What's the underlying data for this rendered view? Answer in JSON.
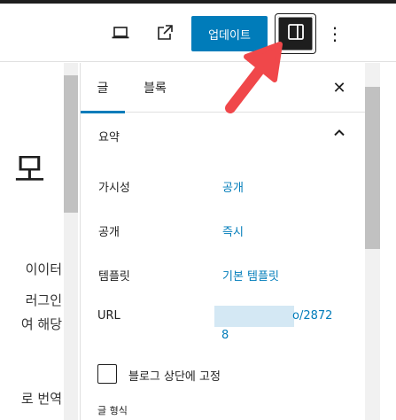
{
  "toolbar": {
    "update_label": "업데이트",
    "more_label": "⋮"
  },
  "canvas": {
    "title": "모",
    "lines": [
      "이이터",
      "러그인",
      "여 해당",
      "로 번역"
    ]
  },
  "sidebar": {
    "tabs": [
      {
        "label": "글"
      },
      {
        "label": "블록"
      }
    ],
    "close_label": "✕",
    "summary_label": "요약",
    "rows": [
      {
        "label": "가시성",
        "value": "공개"
      },
      {
        "label": "공개",
        "value": "즉시"
      },
      {
        "label": "템플릿",
        "value": "기본 템플릿"
      }
    ],
    "url_label": "URL",
    "url_value_line1": "o/2872",
    "url_value_line2": "8",
    "sticky_label": "블로그 상단에 고정",
    "format_label": "글 형식"
  },
  "colors": {
    "accent": "#007cba",
    "arrow": "#f0474a",
    "dark": "#1e1e1e"
  }
}
